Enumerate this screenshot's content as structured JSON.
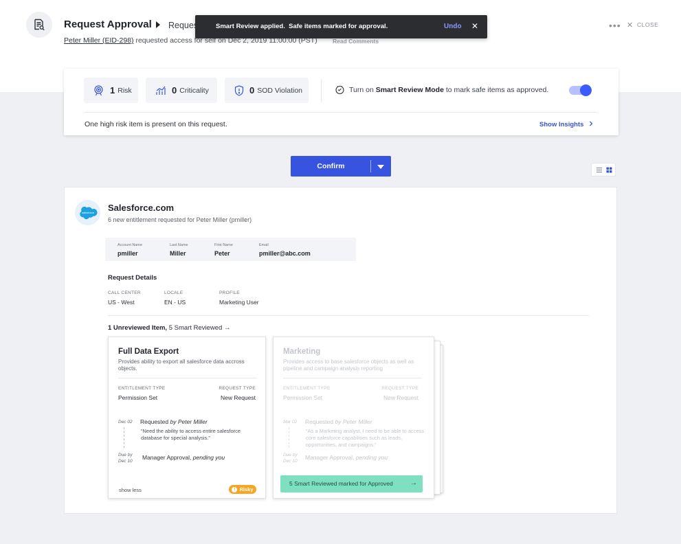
{
  "header": {
    "title": "Request Approval",
    "title_sub": "Request Number Review",
    "requester": "Peter Miller (EID-298)",
    "req_text": "requested access for self on",
    "req_date": "Dec 2, 2019 11:00:00 (PST)",
    "read_comments": "Read Comments",
    "more": "•••",
    "close_x": "✕",
    "close_label": "CLOSE"
  },
  "toast": {
    "message": "Smart Review applied.  Safe items marked for approval.",
    "undo": "Undo",
    "close": "✕"
  },
  "summary": {
    "risk_num": "1",
    "risk_label": "Risk",
    "crit_num": "0",
    "crit_label": "Criticality",
    "sod_num": "0",
    "sod_label": "SOD Violation",
    "smart_pre": "Turn on",
    "smart_bold": "Smart Review Mode",
    "smart_post": "to mark safe items as approved.",
    "toggle_on": true,
    "risk_message": "One high risk item is present on this request.",
    "insights": "Show Insights"
  },
  "confirm": {
    "label": "Confirm"
  },
  "app": {
    "name": "Salesforce.com",
    "logo_text": "salesforce",
    "subtitle": "6 new entitlement requested for Peter Miller (pmiller)",
    "account": [
      {
        "key": "Account Name",
        "value": "pmiller"
      },
      {
        "key": "Last Name",
        "value": "Miller"
      },
      {
        "key": "First Name",
        "value": "Peter"
      },
      {
        "key": "Email",
        "value": "pmiller@abc.com"
      }
    ],
    "details_title": "Request Details",
    "details": [
      {
        "key": "CALL CENTER",
        "value": "US - West"
      },
      {
        "key": "LOCALE",
        "value": "EN - US"
      },
      {
        "key": "PROFILE",
        "value": "Marketing User"
      }
    ],
    "unreviewed_bold": "1 Unreviewed Item,",
    "unreviewed_rest": "5 Smart Reviewed →"
  },
  "card1": {
    "title": "Full Data Export",
    "desc": "Provides ability to export all salesforce data accross objects.",
    "ent_type_k": "ENTITLEMENT TYPE",
    "ent_type_v": "Permission Set",
    "req_type_k": "REQUEST TYPE",
    "req_type_v": "New Request",
    "ev1_date": "Dec 02",
    "ev1_text": "Requested",
    "ev1_by": "by Peter Miller",
    "ev1_quote": "“Need the ability to access entire salesforce database for special analysis.”",
    "ev2_date1": "Due by",
    "ev2_date2": "Dec 10",
    "ev2_text": "Manager Approval,",
    "ev2_status": "pending you",
    "show_less": "show less",
    "badge": "Risky"
  },
  "card2": {
    "title": "Marketing",
    "desc": "Provides access to base salesforce objects as well as pipeline and campaign analysis reporting",
    "ent_type_k": "ENTITLEMENT TYPE",
    "ent_type_v": "Permission Set",
    "req_type_k": "REQUEST TYPE",
    "req_type_v": "New Request",
    "ev1_date": "Mar 02",
    "ev1_text": "Requested",
    "ev1_by": "by Peter Miller",
    "ev1_quote": "“As a Marketing analyst, I need to be able to access core salesforce capabilities such as leads, opportunities, and campaigns.”",
    "ev2_date1": "Due by",
    "ev2_date2": "Dec 10",
    "ev2_text": "Manager Approval,",
    "ev2_status": "pending you",
    "button": "5 Smart Reviewed marked for Approved",
    "button_arrow": "→"
  },
  "colors": {
    "accent": "#3754e0",
    "toast_bg": "#2b2d31",
    "green": "#7fe0c1",
    "risky": "#f5a623"
  },
  "icons": [
    "document-search-icon",
    "risk-icon",
    "criticality-icon",
    "sod-icon",
    "smart-review-icon",
    "chevron-right-icon",
    "list-view-icon",
    "grid-view-icon",
    "salesforce-logo"
  ]
}
